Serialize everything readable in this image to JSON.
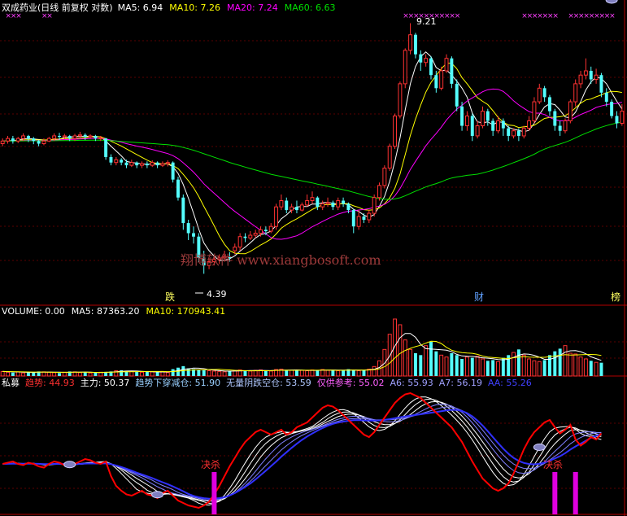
{
  "title": "双成药业(日线 前复权 对数)",
  "colors": {
    "up": "#ff3232",
    "down": "#54ffff",
    "ma5": "#ffffff",
    "ma10": "#ffff00",
    "ma20": "#ff00ff",
    "ma60": "#00e000",
    "grid": "#b40000",
    "indicator_red": "#ff0000",
    "indicator_blue": "#3030ff",
    "bar_magenta": "#e000e0"
  },
  "price_panel": {
    "ma_labels": [
      {
        "label": "MA5: 6.94",
        "color": "#ffffff"
      },
      {
        "label": "MA10: 7.26",
        "color": "#ffff00"
      },
      {
        "label": "MA20: 7.24",
        "color": "#ff00ff"
      },
      {
        "label": "MA60: 6.63",
        "color": "#00e000"
      }
    ],
    "high_label": "9.21",
    "low_label": "4.39",
    "watermark": "翔博软件 www.xiangbosoft.com",
    "markers": [
      {
        "label": "跌",
        "color": "#ffff60"
      },
      {
        "label": "财",
        "color": "#60a0ff"
      },
      {
        "label": "榜",
        "color": "#ffff60"
      }
    ]
  },
  "volume_panel": {
    "labels": [
      {
        "label": "VOLUME: 0.00",
        "color": "#ffffff"
      },
      {
        "label": "MA5: 87363.20",
        "color": "#ffffff"
      },
      {
        "label": "MA10: 170943.41",
        "color": "#ffff00"
      }
    ]
  },
  "indicator_panel": {
    "labels": [
      {
        "label": "私募",
        "color": "#ffffff"
      },
      {
        "label": "趋势: 44.93",
        "color": "#ff3030"
      },
      {
        "label": "主力: 50.37",
        "color": "#ffffff"
      },
      {
        "label": "趋势下穿减仓: 51.90",
        "color": "#9ad0ff"
      },
      {
        "label": "无量阴跌空仓: 53.59",
        "color": "#b0c8ff"
      },
      {
        "label": "仅供参考: 55.02",
        "color": "#ff60ff"
      },
      {
        "label": "A6: 55.93",
        "color": "#a0a0ff"
      },
      {
        "label": "A7: 56.19",
        "color": "#a0a0ff"
      },
      {
        "label": "AA: 55.26",
        "color": "#4040ff"
      }
    ],
    "signal_labels": [
      "决杀",
      "决杀"
    ]
  },
  "chart_data": {
    "type": "candlestick",
    "title": "双成药业(日线 前复权 对数)",
    "price_high": 9.21,
    "price_low": 4.39,
    "current_ma": {
      "MA5": 6.94,
      "MA10": 7.26,
      "MA20": 7.24,
      "MA60": 6.63
    },
    "candles": [
      {
        "o": 6.45,
        "c": 6.5,
        "h": 6.55,
        "l": 6.4
      },
      {
        "o": 6.5,
        "c": 6.55,
        "h": 6.6,
        "l": 6.45
      },
      {
        "o": 6.55,
        "c": 6.5,
        "h": 6.6,
        "l": 6.45
      },
      {
        "o": 6.5,
        "c": 6.55,
        "h": 6.58,
        "l": 6.46
      },
      {
        "o": 6.55,
        "c": 6.6,
        "h": 6.65,
        "l": 6.5
      },
      {
        "o": 6.6,
        "c": 6.55,
        "h": 6.62,
        "l": 6.48
      },
      {
        "o": 6.55,
        "c": 6.5,
        "h": 6.58,
        "l": 6.44
      },
      {
        "o": 6.5,
        "c": 6.45,
        "h": 6.52,
        "l": 6.4
      },
      {
        "o": 6.45,
        "c": 6.5,
        "h": 6.55,
        "l": 6.42
      },
      {
        "o": 6.5,
        "c": 6.55,
        "h": 6.58,
        "l": 6.48
      },
      {
        "o": 6.55,
        "c": 6.6,
        "h": 6.65,
        "l": 6.5
      },
      {
        "o": 6.6,
        "c": 6.58,
        "h": 6.66,
        "l": 6.52
      },
      {
        "o": 6.58,
        "c": 6.6,
        "h": 6.64,
        "l": 6.54
      },
      {
        "o": 6.6,
        "c": 6.55,
        "h": 6.62,
        "l": 6.5
      },
      {
        "o": 6.55,
        "c": 6.6,
        "h": 6.64,
        "l": 6.5
      },
      {
        "o": 6.6,
        "c": 6.62,
        "h": 6.68,
        "l": 6.55
      },
      {
        "o": 6.62,
        "c": 6.58,
        "h": 6.65,
        "l": 6.52
      },
      {
        "o": 6.58,
        "c": 6.6,
        "h": 6.63,
        "l": 6.54
      },
      {
        "o": 6.6,
        "c": 6.55,
        "h": 6.62,
        "l": 6.5
      },
      {
        "o": 6.55,
        "c": 6.56,
        "h": 6.6,
        "l": 6.5
      },
      {
        "o": 6.55,
        "c": 6.2,
        "h": 6.56,
        "l": 6.15
      },
      {
        "o": 6.2,
        "c": 6.1,
        "h": 6.25,
        "l": 6.05
      },
      {
        "o": 6.1,
        "c": 6.15,
        "h": 6.2,
        "l": 6.05
      },
      {
        "o": 6.15,
        "c": 6.1,
        "h": 6.18,
        "l": 6.05
      },
      {
        "o": 6.1,
        "c": 6.05,
        "h": 6.15,
        "l": 6.0
      },
      {
        "o": 6.05,
        "c": 6.1,
        "h": 6.15,
        "l": 6.02
      },
      {
        "o": 6.1,
        "c": 6.05,
        "h": 6.12,
        "l": 6.0
      },
      {
        "o": 6.05,
        "c": 6.08,
        "h": 6.12,
        "l": 6.0
      },
      {
        "o": 6.08,
        "c": 6.05,
        "h": 6.12,
        "l": 6.0
      },
      {
        "o": 6.05,
        "c": 6.1,
        "h": 6.14,
        "l": 6.02
      },
      {
        "o": 6.1,
        "c": 6.05,
        "h": 6.12,
        "l": 6.0
      },
      {
        "o": 6.05,
        "c": 6.08,
        "h": 6.12,
        "l": 6.02
      },
      {
        "o": 6.08,
        "c": 6.1,
        "h": 6.14,
        "l": 6.03
      },
      {
        "o": 6.1,
        "c": 5.8,
        "h": 6.12,
        "l": 5.75
      },
      {
        "o": 5.8,
        "c": 5.5,
        "h": 5.85,
        "l": 5.45
      },
      {
        "o": 5.5,
        "c": 5.1,
        "h": 5.55,
        "l": 5.0
      },
      {
        "o": 5.1,
        "c": 4.95,
        "h": 5.15,
        "l": 4.85
      },
      {
        "o": 4.95,
        "c": 4.9,
        "h": 5.05,
        "l": 4.8
      },
      {
        "o": 4.9,
        "c": 4.6,
        "h": 4.95,
        "l": 4.55
      },
      {
        "o": 4.6,
        "c": 4.5,
        "h": 4.7,
        "l": 4.39
      },
      {
        "o": 4.5,
        "c": 4.55,
        "h": 4.6,
        "l": 4.45
      },
      {
        "o": 4.55,
        "c": 4.58,
        "h": 4.62,
        "l": 4.5
      },
      {
        "o": 4.58,
        "c": 4.6,
        "h": 4.65,
        "l": 4.52
      },
      {
        "o": 4.6,
        "c": 4.62,
        "h": 4.7,
        "l": 4.55
      },
      {
        "o": 4.62,
        "c": 4.6,
        "h": 4.68,
        "l": 4.55
      },
      {
        "o": 4.7,
        "c": 4.75,
        "h": 4.8,
        "l": 4.65
      },
      {
        "o": 4.75,
        "c": 4.9,
        "h": 4.95,
        "l": 4.7
      },
      {
        "o": 4.9,
        "c": 4.88,
        "h": 4.95,
        "l": 4.82
      },
      {
        "o": 4.88,
        "c": 4.92,
        "h": 4.98,
        "l": 4.85
      },
      {
        "o": 4.92,
        "c": 4.95,
        "h": 5.0,
        "l": 4.88
      },
      {
        "o": 4.95,
        "c": 5.0,
        "h": 5.05,
        "l": 4.9
      },
      {
        "o": 5.0,
        "c": 4.98,
        "h": 5.05,
        "l": 4.92
      },
      {
        "o": 4.98,
        "c": 5.05,
        "h": 5.1,
        "l": 4.95
      },
      {
        "o": 5.05,
        "c": 5.35,
        "h": 5.4,
        "l": 5.0
      },
      {
        "o": 5.35,
        "c": 5.45,
        "h": 5.55,
        "l": 5.3
      },
      {
        "o": 5.45,
        "c": 5.3,
        "h": 5.5,
        "l": 5.25
      },
      {
        "o": 5.3,
        "c": 5.35,
        "h": 5.4,
        "l": 5.25
      },
      {
        "o": 5.35,
        "c": 5.3,
        "h": 5.45,
        "l": 5.25
      },
      {
        "o": 5.3,
        "c": 5.38,
        "h": 5.42,
        "l": 5.28
      },
      {
        "o": 5.38,
        "c": 5.45,
        "h": 5.55,
        "l": 5.35
      },
      {
        "o": 5.45,
        "c": 5.5,
        "h": 5.6,
        "l": 5.4
      },
      {
        "o": 5.5,
        "c": 5.35,
        "h": 5.52,
        "l": 5.3
      },
      {
        "o": 5.35,
        "c": 5.4,
        "h": 5.45,
        "l": 5.3
      },
      {
        "o": 5.4,
        "c": 5.42,
        "h": 5.5,
        "l": 5.35
      },
      {
        "o": 5.42,
        "c": 5.35,
        "h": 5.45,
        "l": 5.3
      },
      {
        "o": 5.35,
        "c": 5.45,
        "h": 5.5,
        "l": 5.3
      },
      {
        "o": 5.45,
        "c": 5.4,
        "h": 5.5,
        "l": 5.35
      },
      {
        "o": 5.4,
        "c": 5.3,
        "h": 5.42,
        "l": 5.25
      },
      {
        "o": 5.3,
        "c": 5.05,
        "h": 5.32,
        "l": 4.95
      },
      {
        "o": 5.05,
        "c": 5.2,
        "h": 5.3,
        "l": 5.0
      },
      {
        "o": 5.2,
        "c": 5.15,
        "h": 5.25,
        "l": 5.1
      },
      {
        "o": 5.15,
        "c": 5.25,
        "h": 5.3,
        "l": 5.1
      },
      {
        "o": 5.25,
        "c": 5.5,
        "h": 5.55,
        "l": 5.2
      },
      {
        "o": 5.5,
        "c": 5.7,
        "h": 5.75,
        "l": 5.45
      },
      {
        "o": 5.7,
        "c": 6.0,
        "h": 6.05,
        "l": 5.65
      },
      {
        "o": 6.0,
        "c": 6.4,
        "h": 6.45,
        "l": 5.95
      },
      {
        "o": 6.4,
        "c": 7.0,
        "h": 7.05,
        "l": 6.35
      },
      {
        "o": 7.0,
        "c": 7.7,
        "h": 7.75,
        "l": 6.95
      },
      {
        "o": 7.7,
        "c": 8.5,
        "h": 8.55,
        "l": 7.6
      },
      {
        "o": 8.5,
        "c": 8.9,
        "h": 9.21,
        "l": 8.4
      },
      {
        "o": 8.9,
        "c": 8.4,
        "h": 8.95,
        "l": 8.3
      },
      {
        "o": 8.4,
        "c": 8.2,
        "h": 8.5,
        "l": 8.0
      },
      {
        "o": 8.2,
        "c": 8.3,
        "h": 8.4,
        "l": 8.1
      },
      {
        "o": 8.3,
        "c": 7.9,
        "h": 8.35,
        "l": 7.8
      },
      {
        "o": 7.9,
        "c": 7.6,
        "h": 8.0,
        "l": 7.5
      },
      {
        "o": 7.6,
        "c": 8.0,
        "h": 8.1,
        "l": 7.55
      },
      {
        "o": 8.0,
        "c": 8.3,
        "h": 8.4,
        "l": 7.95
      },
      {
        "o": 8.3,
        "c": 7.7,
        "h": 8.35,
        "l": 7.6
      },
      {
        "o": 7.7,
        "c": 7.2,
        "h": 7.8,
        "l": 7.1
      },
      {
        "o": 7.2,
        "c": 6.8,
        "h": 7.3,
        "l": 6.7
      },
      {
        "o": 6.8,
        "c": 7.0,
        "h": 7.1,
        "l": 6.7
      },
      {
        "o": 7.0,
        "c": 6.6,
        "h": 7.05,
        "l": 6.5
      },
      {
        "o": 6.6,
        "c": 6.8,
        "h": 6.9,
        "l": 6.55
      },
      {
        "o": 6.8,
        "c": 7.1,
        "h": 7.2,
        "l": 6.75
      },
      {
        "o": 7.1,
        "c": 6.9,
        "h": 7.15,
        "l": 6.8
      },
      {
        "o": 6.9,
        "c": 6.7,
        "h": 6.95,
        "l": 6.6
      },
      {
        "o": 6.7,
        "c": 6.9,
        "h": 7.0,
        "l": 6.65
      },
      {
        "o": 6.9,
        "c": 6.75,
        "h": 6.95,
        "l": 6.6
      },
      {
        "o": 6.75,
        "c": 6.6,
        "h": 6.8,
        "l": 6.5
      },
      {
        "o": 6.6,
        "c": 6.7,
        "h": 6.75,
        "l": 6.55
      },
      {
        "o": 6.7,
        "c": 6.6,
        "h": 6.75,
        "l": 6.5
      },
      {
        "o": 6.6,
        "c": 6.75,
        "h": 6.8,
        "l": 6.55
      },
      {
        "o": 6.75,
        "c": 6.9,
        "h": 7.0,
        "l": 6.7
      },
      {
        "o": 6.9,
        "c": 7.3,
        "h": 7.4,
        "l": 6.85
      },
      {
        "o": 7.3,
        "c": 7.6,
        "h": 7.7,
        "l": 7.25
      },
      {
        "o": 7.6,
        "c": 7.4,
        "h": 7.65,
        "l": 7.3
      },
      {
        "o": 7.4,
        "c": 7.1,
        "h": 7.45,
        "l": 7.0
      },
      {
        "o": 7.1,
        "c": 6.8,
        "h": 7.15,
        "l": 6.7
      },
      {
        "o": 6.8,
        "c": 6.7,
        "h": 6.9,
        "l": 6.6
      },
      {
        "o": 6.7,
        "c": 6.9,
        "h": 6.95,
        "l": 6.65
      },
      {
        "o": 6.9,
        "c": 7.3,
        "h": 7.35,
        "l": 6.85
      },
      {
        "o": 7.3,
        "c": 7.7,
        "h": 7.8,
        "l": 7.2
      },
      {
        "o": 7.7,
        "c": 7.9,
        "h": 8.0,
        "l": 7.6
      },
      {
        "o": 7.9,
        "c": 8.0,
        "h": 8.3,
        "l": 7.8
      },
      {
        "o": 8.0,
        "c": 7.8,
        "h": 8.1,
        "l": 7.7
      },
      {
        "o": 7.8,
        "c": 7.9,
        "h": 8.05,
        "l": 7.7
      },
      {
        "o": 7.9,
        "c": 7.5,
        "h": 7.95,
        "l": 7.4
      },
      {
        "o": 7.5,
        "c": 7.3,
        "h": 7.6,
        "l": 7.2
      },
      {
        "o": 7.3,
        "c": 7.0,
        "h": 7.35,
        "l": 6.95
      },
      {
        "o": 7.0,
        "c": 6.85,
        "h": 7.1,
        "l": 6.75
      },
      {
        "o": 6.85,
        "c": 7.1,
        "h": 7.25,
        "l": 6.8
      }
    ],
    "volume": [
      12,
      10,
      9,
      11,
      8,
      10,
      9,
      12,
      11,
      10,
      9,
      8,
      10,
      12,
      11,
      9,
      10,
      8,
      9,
      10,
      11,
      12,
      14,
      15,
      13,
      12,
      11,
      10,
      12,
      11,
      10,
      12,
      9,
      18,
      22,
      26,
      20,
      18,
      17,
      15,
      14,
      13,
      12,
      11,
      14,
      15,
      16,
      14,
      13,
      15,
      16,
      14,
      13,
      17,
      18,
      16,
      15,
      14,
      15,
      14,
      16,
      15,
      17,
      15,
      16,
      14,
      15,
      18,
      16,
      14,
      15,
      18,
      25,
      40,
      70,
      110,
      150,
      135,
      95,
      70,
      60,
      55,
      80,
      90,
      65,
      55,
      50,
      60,
      55,
      45,
      50,
      48,
      52,
      45,
      40,
      42,
      38,
      48,
      55,
      62,
      70,
      55,
      45,
      40,
      38,
      42,
      55,
      65,
      72,
      80,
      60,
      58,
      50,
      45,
      40,
      36,
      35
    ],
    "indicator": {
      "trend_red": [
        40,
        41,
        42,
        40,
        39,
        41,
        40,
        38,
        37,
        40,
        42,
        41,
        39,
        38,
        40,
        42,
        44,
        43,
        41,
        40,
        42,
        30,
        22,
        18,
        15,
        14,
        16,
        18,
        15,
        14,
        12,
        16,
        18,
        14,
        10,
        8,
        6,
        5,
        4,
        6,
        9,
        15,
        22,
        30,
        38,
        45,
        52,
        58,
        62,
        66,
        68,
        66,
        64,
        66,
        68,
        64,
        66,
        70,
        72,
        74,
        78,
        82,
        86,
        88,
        87,
        84,
        80,
        76,
        72,
        68,
        64,
        62,
        66,
        72,
        78,
        84,
        90,
        94,
        97,
        98,
        96,
        94,
        90,
        86,
        82,
        78,
        74,
        70,
        64,
        58,
        50,
        42,
        35,
        28,
        24,
        20,
        18,
        20,
        24,
        32,
        42,
        52,
        60,
        66,
        70,
        74,
        76,
        70,
        65,
        68,
        72,
        60,
        55,
        58,
        62,
        60,
        65
      ]
    },
    "signals": [
      {
        "type": "决杀",
        "index": 41
      },
      {
        "type": "决杀",
        "index": 107
      },
      {
        "type": "决杀",
        "index": 111
      }
    ]
  }
}
